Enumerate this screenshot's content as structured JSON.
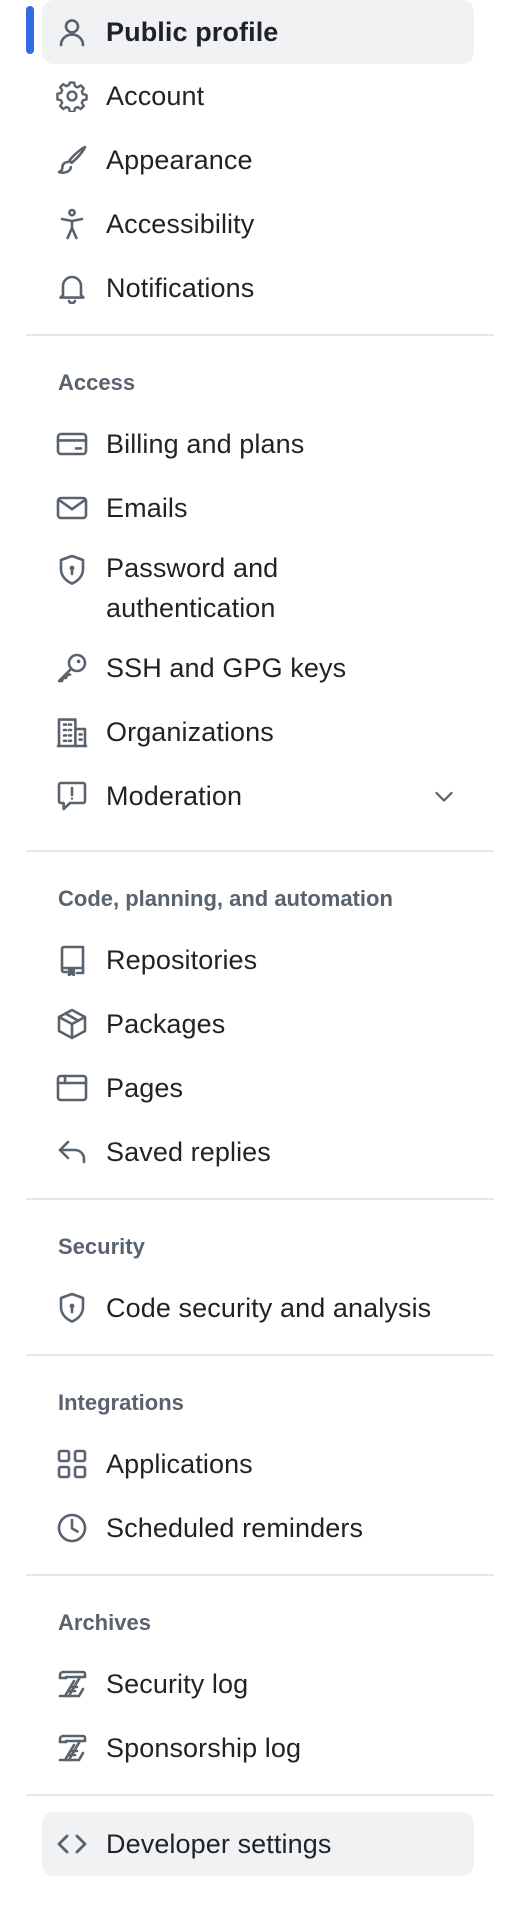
{
  "colors": {
    "accent": "#2f6ce5",
    "selected_bg": "#f0f2f4",
    "text": "#1f2328",
    "muted": "#59636e",
    "divider": "#e3e6ea"
  },
  "top_items": [
    {
      "label": "Public profile",
      "icon": "person-icon",
      "selected": true
    },
    {
      "label": "Account",
      "icon": "gear-icon"
    },
    {
      "label": "Appearance",
      "icon": "paintbrush-icon"
    },
    {
      "label": "Accessibility",
      "icon": "accessibility-icon"
    },
    {
      "label": "Notifications",
      "icon": "bell-icon"
    }
  ],
  "access": {
    "heading": "Access",
    "items": [
      {
        "label": "Billing and plans",
        "icon": "credit-card-icon"
      },
      {
        "label": "Emails",
        "icon": "mail-icon"
      },
      {
        "label": "Password and authentication",
        "icon": "shield-lock-icon"
      },
      {
        "label": "SSH and GPG keys",
        "icon": "key-icon"
      },
      {
        "label": "Organizations",
        "icon": "organization-icon"
      },
      {
        "label": "Moderation",
        "icon": "report-icon",
        "expandable": true
      }
    ]
  },
  "code": {
    "heading": "Code, planning, and automation",
    "items": [
      {
        "label": "Repositories",
        "icon": "repo-icon"
      },
      {
        "label": "Packages",
        "icon": "package-icon"
      },
      {
        "label": "Pages",
        "icon": "browser-icon"
      },
      {
        "label": "Saved replies",
        "icon": "reply-icon"
      }
    ]
  },
  "security": {
    "heading": "Security",
    "items": [
      {
        "label": "Code security and analysis",
        "icon": "shield-lock-icon"
      }
    ]
  },
  "integrations": {
    "heading": "Integrations",
    "items": [
      {
        "label": "Applications",
        "icon": "apps-icon"
      },
      {
        "label": "Scheduled reminders",
        "icon": "clock-icon"
      }
    ]
  },
  "archives": {
    "heading": "Archives",
    "items": [
      {
        "label": "Security log",
        "icon": "log-icon"
      },
      {
        "label": "Sponsorship log",
        "icon": "log-icon"
      }
    ]
  },
  "developer": {
    "label": "Developer settings",
    "icon": "code-icon"
  }
}
